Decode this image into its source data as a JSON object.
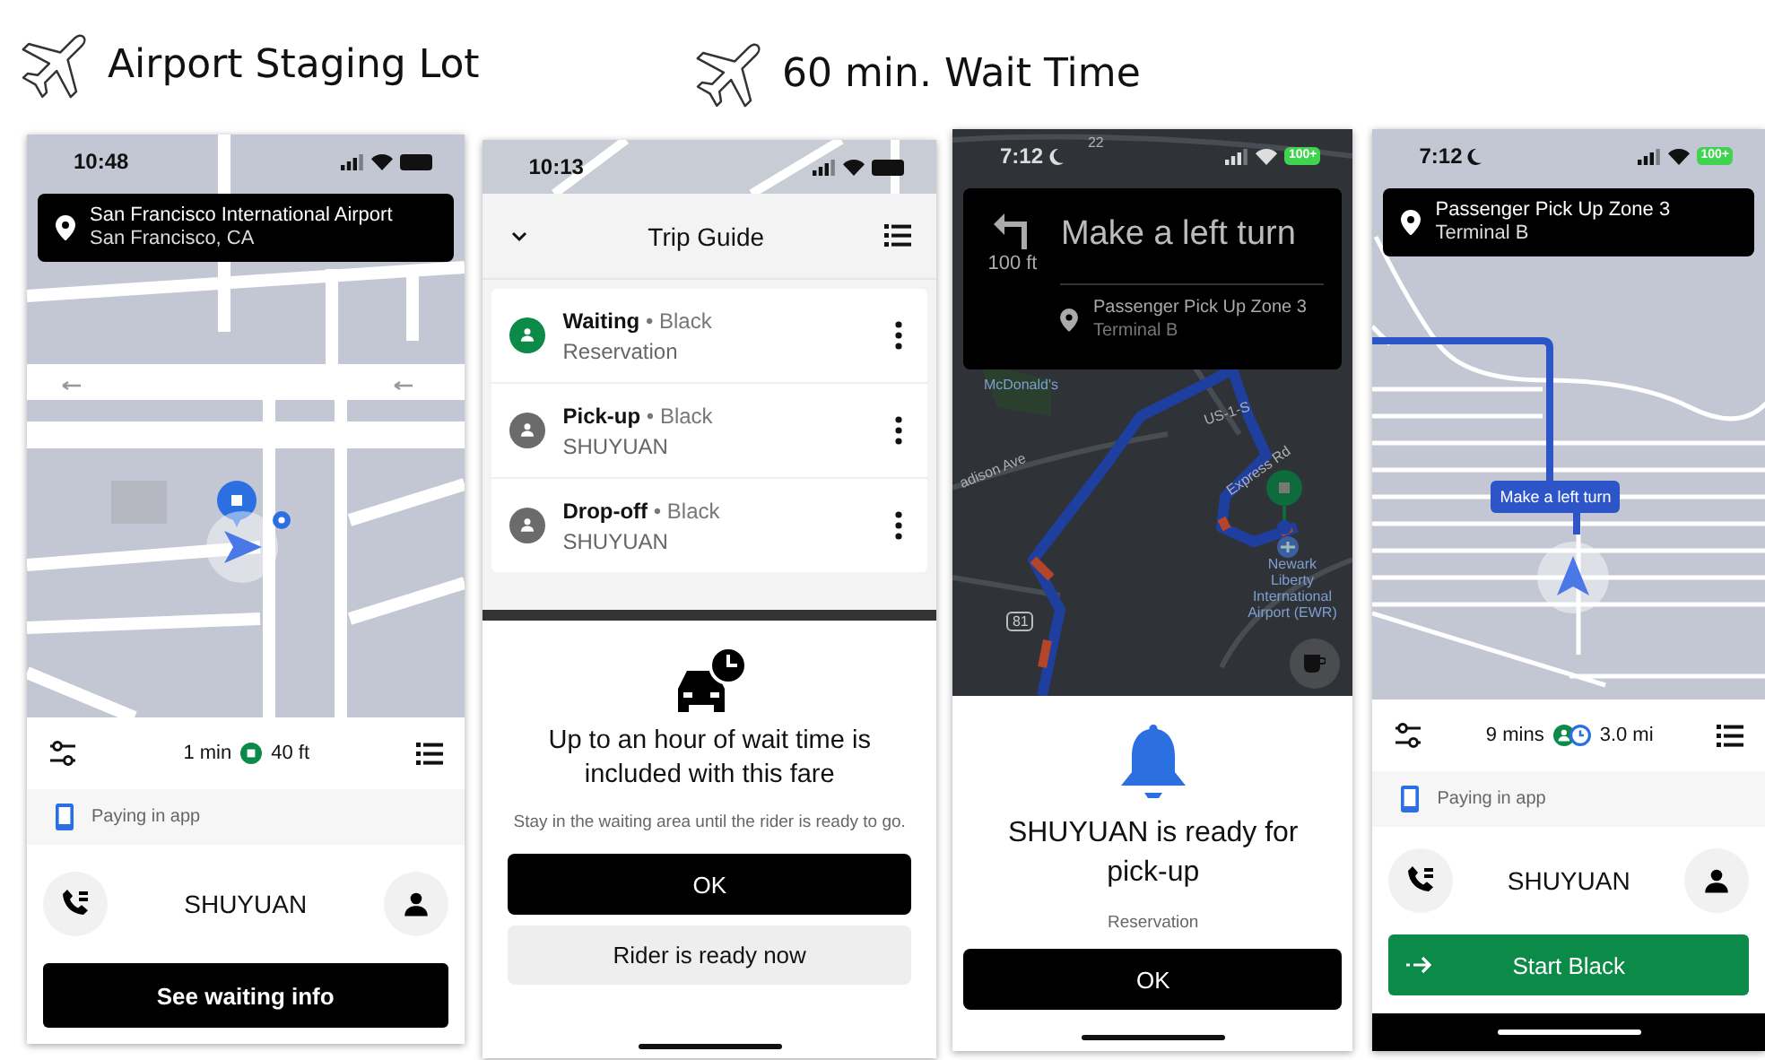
{
  "headings": [
    {
      "text": "Airport Staging Lot"
    },
    {
      "text": "60 min. Wait Time"
    }
  ],
  "screens": [
    {
      "kind": "waiting",
      "status_time": "10:48",
      "focus_mode": false,
      "destination": {
        "title": "San Francisco International Airport",
        "subtitle": "San Francisco, CA"
      },
      "trip_bar": {
        "kind": "stop",
        "eta": "1 min",
        "distance": "40 ft"
      },
      "payment": "Paying in app",
      "rider": "SHUYUAN",
      "action": {
        "kind": "primary",
        "label": "See waiting info"
      }
    },
    {
      "kind": "trip_guide",
      "status_time": "10:13",
      "focus_mode": false,
      "title": "Trip Guide",
      "stops": [
        {
          "title": "**Waiting** • Black",
          "subtitle": "Reservation",
          "active": true
        },
        {
          "title": "**Pick-up** • Black",
          "subtitle": "SHUYUAN",
          "active": false
        },
        {
          "title": "**Drop-off** • Black",
          "subtitle": "SHUYUAN",
          "active": false
        }
      ],
      "sheet": {
        "headline": "Up to an hour of wait time is included with this fare",
        "body": "Stay in the waiting area until the rider is ready to go.",
        "buttons": [
          {
            "kind": "primary",
            "label": "OK"
          },
          {
            "kind": "secondary",
            "label": "Rider is ready now"
          }
        ]
      }
    },
    {
      "kind": "ready",
      "status_time": "7:12",
      "focus_mode": true,
      "battery": "100+",
      "instruction": {
        "distance": "100 ft",
        "text": "Make a left turn",
        "place": "Passenger Pick Up Zone 3",
        "subtitle": "Terminal B"
      },
      "map_labels": [
        {
          "kind": "road",
          "text": "22"
        },
        {
          "kind": "place",
          "text": "McDonald's"
        },
        {
          "kind": "road",
          "text": "US-1-S"
        },
        {
          "kind": "road",
          "text": "adison Ave"
        },
        {
          "kind": "road",
          "text": "Express Rd"
        },
        {
          "kind": "place",
          "text": "Newark Liberty International Airport (EWR)"
        },
        {
          "kind": "shield",
          "text": "81"
        }
      ],
      "sheet": {
        "headline": "SHUYUAN is ready for pick-up",
        "subtitle": "Reservation",
        "button": "OK"
      }
    },
    {
      "kind": "navigation",
      "status_time": "7:12",
      "focus_mode": true,
      "battery": "100+",
      "destination": {
        "title": "Passenger Pick Up Zone 3",
        "subtitle": "Terminal B"
      },
      "callout": "Make a left turn",
      "trip_bar": {
        "kind": "rider_clock",
        "eta": "9 mins",
        "distance": "3.0 mi"
      },
      "payment": "Paying in app",
      "rider": "SHUYUAN",
      "action": {
        "kind": "start",
        "label": "Start Black"
      }
    }
  ]
}
